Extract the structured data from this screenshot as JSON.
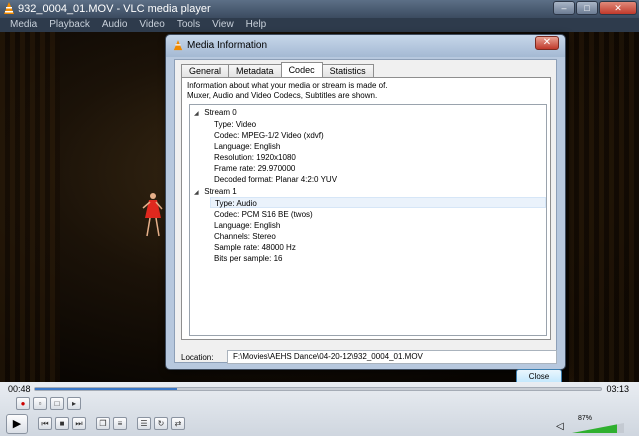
{
  "window": {
    "title": "932_0004_01.MOV - VLC media player",
    "controls": [
      "–",
      "□",
      "✕"
    ]
  },
  "menubar": [
    "Media",
    "Playback",
    "Audio",
    "Video",
    "Tools",
    "View",
    "Help"
  ],
  "player": {
    "elapsed": "00:48",
    "duration": "03:13",
    "progress": 0.25,
    "volume_label": "87%",
    "volume": 0.87,
    "icons": {
      "record": "●",
      "snapshot": "▫",
      "loop_ab": "□",
      "frame_step": "▸",
      "play": "▶",
      "prev": "⏮",
      "stop": "■",
      "next": "⏭",
      "fullscreen": "❐",
      "extended": "≡",
      "playlist": "☰",
      "loop": "↻",
      "shuffle": "⇄",
      "speaker": "◁"
    }
  },
  "dialog": {
    "title": "Media Information",
    "close_glyph": "✕",
    "tabs": [
      "General",
      "Metadata",
      "Codec",
      "Statistics"
    ],
    "active_tab": "Codec",
    "description_line1": "Information about what your media or stream is made of.",
    "description_line2": "Muxer, Audio and Video Codecs, Subtitles are shown.",
    "tree_toggle": "◢",
    "streams": [
      {
        "name": "Stream 0",
        "properties": [
          "Type: Video",
          "Codec: MPEG-1/2 Video (xdvf)",
          "Language: English",
          "Resolution: 1920x1080",
          "Frame rate: 29.970000",
          "Decoded format: Planar 4:2:0 YUV"
        ]
      },
      {
        "name": "Stream 1",
        "properties": [
          "Type: Audio",
          "Codec: PCM S16 BE (twos)",
          "Language: English",
          "Channels: Stereo",
          "Sample rate: 48000 Hz",
          "Bits per sample: 16"
        ]
      }
    ],
    "location_label": "Location:",
    "location_value": "F:\\Movies\\AEHS Dance\\04-20-12\\932_0004_01.MOV",
    "close_button": "Close"
  }
}
